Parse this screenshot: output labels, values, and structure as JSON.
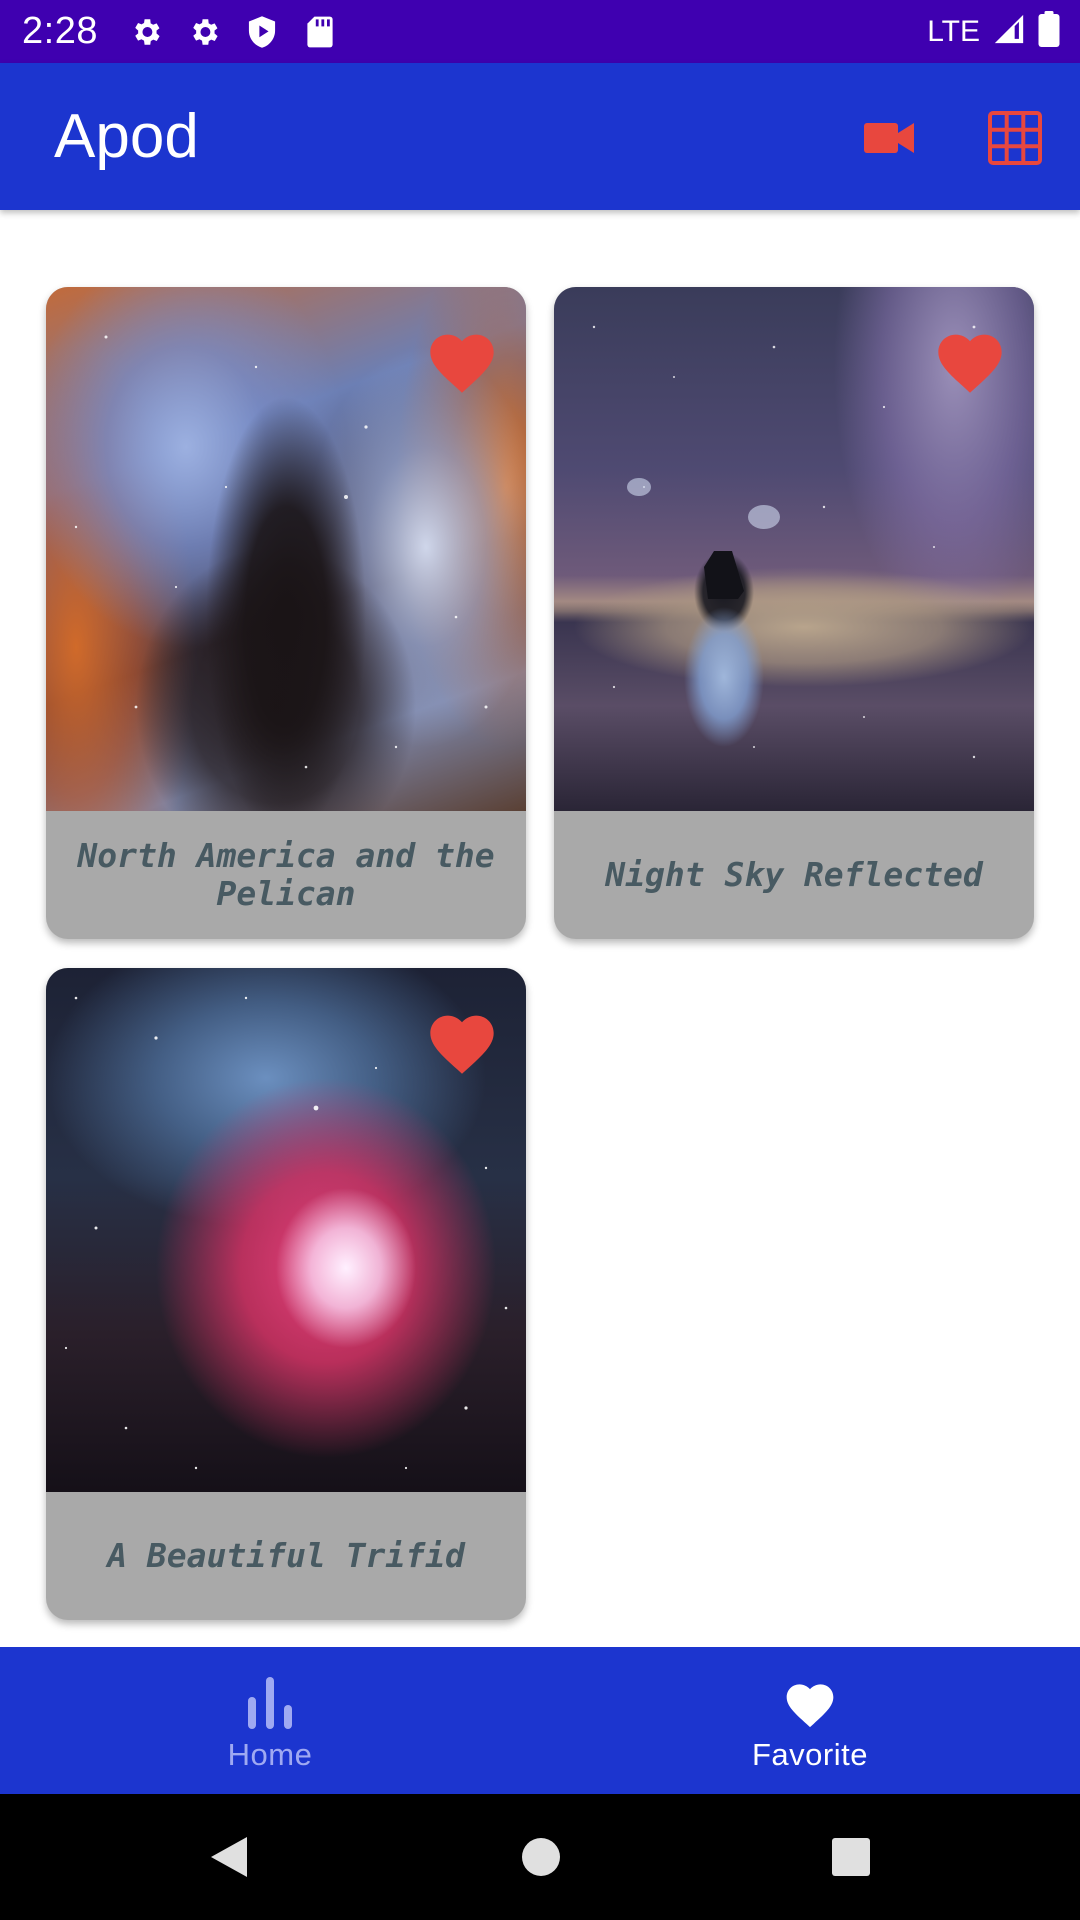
{
  "status_bar": {
    "time": "2:28",
    "network": "LTE",
    "icons": [
      "settings-icon",
      "settings-icon",
      "play-protect-icon",
      "sd-card-icon",
      "signal-icon",
      "battery-icon"
    ]
  },
  "app_bar": {
    "title": "Apod",
    "actions": [
      "video-icon",
      "grid-view-icon"
    ],
    "accent_color": "#E8473E",
    "background_color": "#1C35CF"
  },
  "favorites": [
    {
      "title": "North America and the Pelican",
      "favorited": true
    },
    {
      "title": "Night Sky Reflected",
      "favorited": true
    },
    {
      "title": "A Beautiful Trifid",
      "favorited": true
    }
  ],
  "bottom_nav": {
    "items": [
      {
        "label": "Home",
        "icon": "bar-chart-icon",
        "selected": false
      },
      {
        "label": "Favorite",
        "icon": "heart-icon",
        "selected": true
      }
    ]
  },
  "system_nav": [
    "back-icon",
    "home-icon",
    "recents-icon"
  ]
}
